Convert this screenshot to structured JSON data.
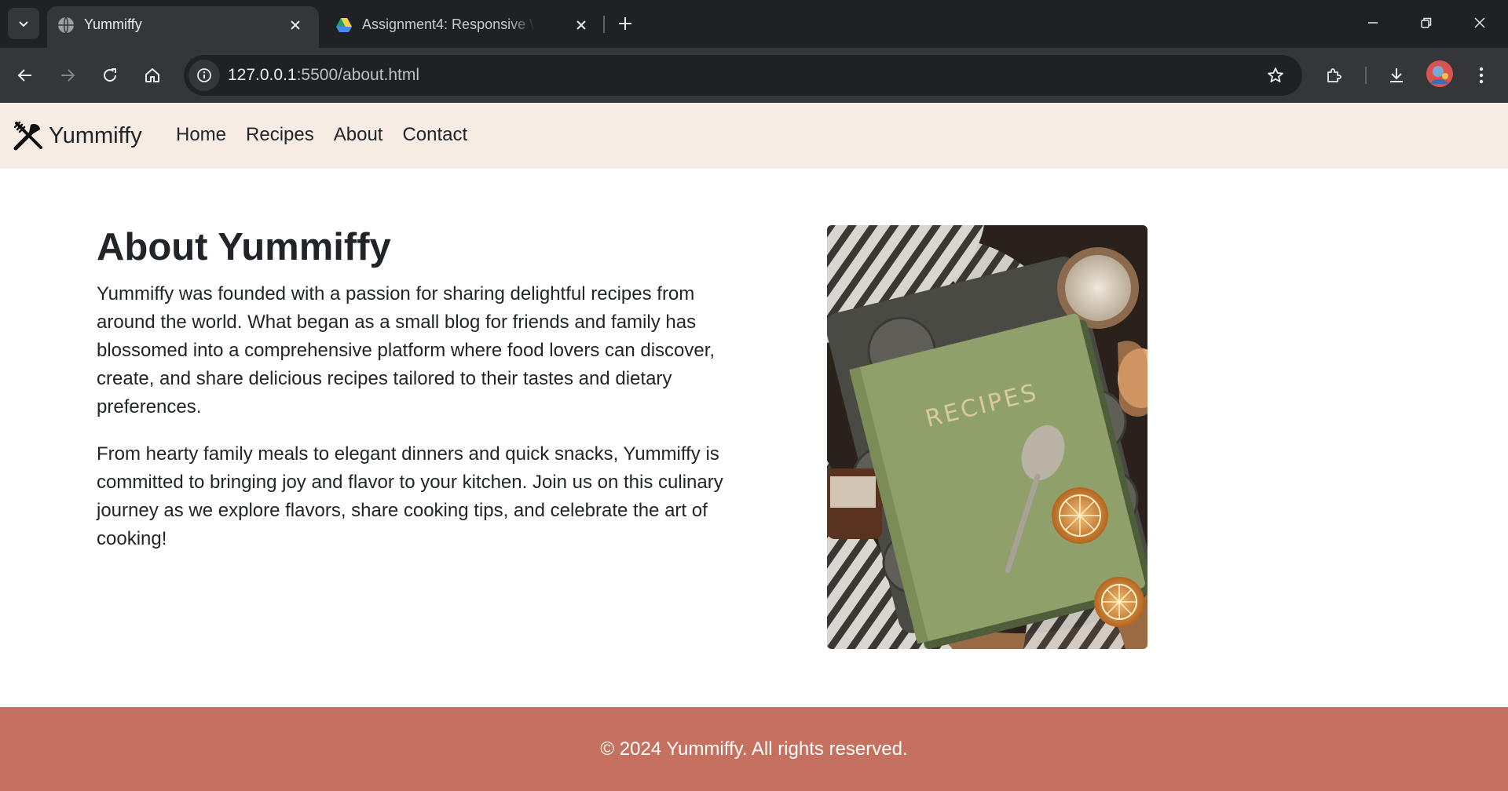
{
  "browser": {
    "tabs": [
      {
        "title": "Yummiffy",
        "active": true
      },
      {
        "title": "Assignment4: Responsive Webpage",
        "active": false
      }
    ],
    "url_host": "127.0.0.1",
    "url_path": ":5500/about.html"
  },
  "site": {
    "brand": "Yummiffy",
    "nav": [
      "Home",
      "Recipes",
      "About",
      "Contact"
    ]
  },
  "about": {
    "heading": "About Yummiffy",
    "paragraphs": [
      "Yummiffy was founded with a passion for sharing delightful recipes from around the world. What began as a small blog for friends and family has blossomed into a comprehensive platform where food lovers can discover, create, and share delicious recipes tailored to their tastes and dietary preferences.",
      "From hearty family meals to elegant dinners and quick snacks, Yummiffy is committed to bringing joy and flavor to your kitchen. Join us on this culinary journey as we explore flavors, share cooking tips, and celebrate the art of cooking!"
    ],
    "image_label": "RECIPES"
  },
  "footer": {
    "text": "© 2024 Yummiffy. All rights reserved."
  },
  "colors": {
    "navbar_bg": "#f7ece3",
    "footer_bg": "#c6705f",
    "chrome_dark": "#202124",
    "chrome_tab": "#35363a"
  },
  "icons": [
    "tab-list-icon",
    "globe-icon",
    "drive-icon",
    "close-icon",
    "plus-icon",
    "minimize-icon",
    "restore-icon",
    "back-icon",
    "forward-icon",
    "reload-icon",
    "home-icon",
    "site-info-icon",
    "star-icon",
    "extensions-icon",
    "download-icon",
    "menu-icon",
    "utensils-icon"
  ]
}
